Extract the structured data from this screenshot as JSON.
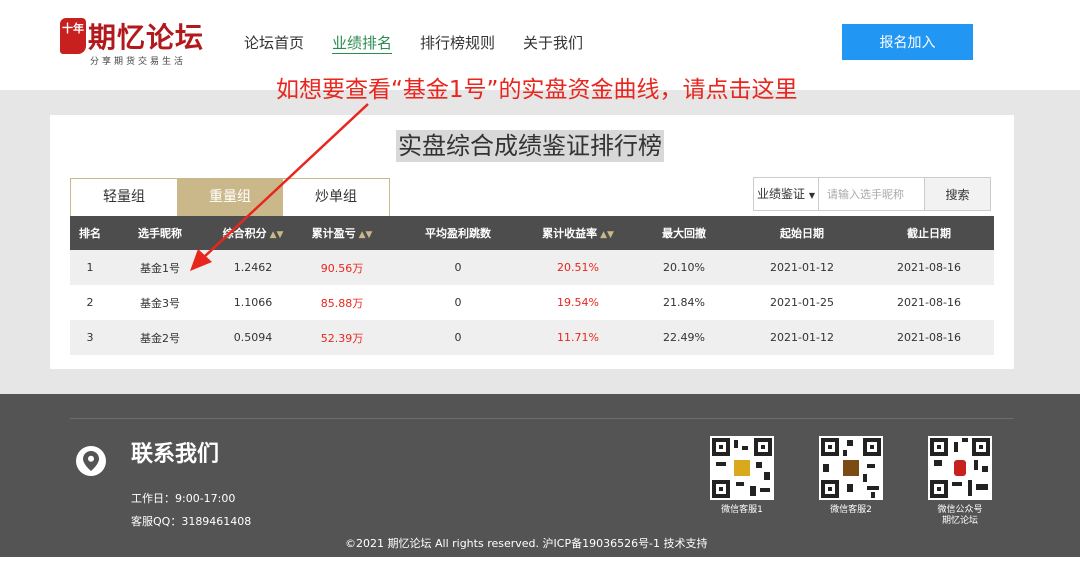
{
  "logo": {
    "seal": "十年",
    "name": "期忆论坛",
    "tagline": "分享期货交易生活"
  },
  "nav": {
    "items": [
      "论坛首页",
      "业绩排名",
      "排行榜规则",
      "关于我们"
    ],
    "active": "业绩排名"
  },
  "join_label": "报名加入",
  "annotation": "如想要查看“基金1号”的实盘资金曲线，请点击这里",
  "page_title": "实盘综合成绩鉴证排行榜",
  "tabs": [
    "轻量组",
    "重量组",
    "炒单组"
  ],
  "active_tab": "重量组",
  "filter": {
    "select_value": "业绩鉴证",
    "placeholder": "请输入选手昵称",
    "search_label": "搜索"
  },
  "table": {
    "headers": [
      "排名",
      "选手昵称",
      "综合积分",
      "累计盈亏",
      "平均盈利跳数",
      "累计收益率",
      "最大回撤",
      "起始日期",
      "截止日期"
    ],
    "rows": [
      [
        "1",
        "基金1号",
        "1.2462",
        "90.56万",
        "0",
        "20.51%",
        "20.10%",
        "2021-01-12",
        "2021-08-16"
      ],
      [
        "2",
        "基金3号",
        "1.1066",
        "85.88万",
        "0",
        "19.54%",
        "21.84%",
        "2021-01-25",
        "2021-08-16"
      ],
      [
        "3",
        "基金2号",
        "0.5094",
        "52.39万",
        "0",
        "11.71%",
        "22.49%",
        "2021-01-12",
        "2021-08-16"
      ]
    ]
  },
  "footer": {
    "contact_title": "联系我们",
    "hours": "工作日：9:00-17:00",
    "qq": "客服QQ：3189461408",
    "qr": [
      "微信客服1",
      "微信客服2",
      "微信公众号\n期忆论坛"
    ],
    "copyright": "©2021 期忆论坛 All rights reserved.  沪ICP备19036526号-1  技术支持"
  },
  "colors": {
    "accent_red": "#e8261e",
    "brand_red": "#b2191c",
    "gold": "#cbb88a",
    "blue": "#2196f3",
    "green": "#2a8c4f"
  }
}
